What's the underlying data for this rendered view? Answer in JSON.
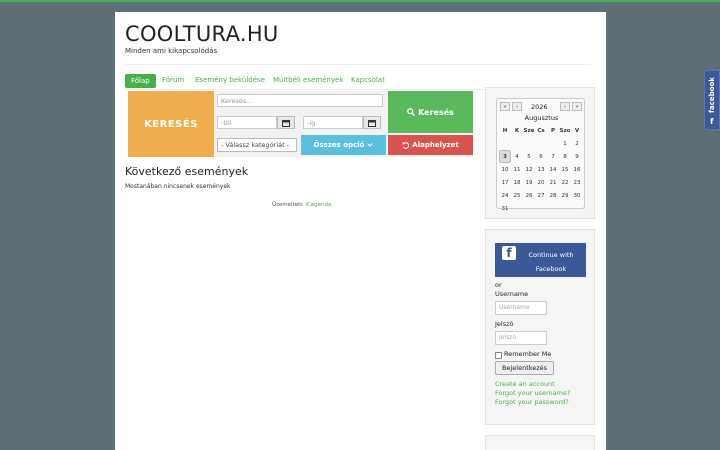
{
  "site": {
    "title": "COOLTURA.HU",
    "subtitle": "Minden ami kikapcsolódás"
  },
  "nav": {
    "items": [
      {
        "label": "Főlap",
        "active": true
      },
      {
        "label": "Fórum"
      },
      {
        "label": "Esemény beküldése"
      },
      {
        "label": "Múltbéli események"
      },
      {
        "label": "Kapcsolat"
      }
    ]
  },
  "search": {
    "label": "KERESÉS",
    "keyword_placeholder": "Keresés...",
    "from_placeholder": "-tól",
    "to_placeholder": "-ig",
    "category_value": "- Válassz kategóriát -",
    "search_button": "Keresés",
    "options_button": "Összes opció",
    "reset_button": "Alaphelyzet"
  },
  "events": {
    "heading": "Következő események",
    "empty_text": "Mostanában nincsenek események",
    "powered_by": "Üzemelteti:",
    "powered_link": "iCagenda"
  },
  "calendar": {
    "nav_prev_year": "«",
    "nav_prev_month": "‹",
    "nav_next_month": "›",
    "nav_next_year": "»",
    "year": "2026",
    "month": "Augusztus",
    "weekdays": [
      "H",
      "K",
      "Sze",
      "Cs",
      "P",
      "Szo",
      "V"
    ],
    "weeks": [
      [
        "",
        "",
        "",
        "",
        "",
        "1",
        "2"
      ],
      [
        "3",
        "4",
        "5",
        "6",
        "7",
        "8",
        "9"
      ],
      [
        "10",
        "11",
        "12",
        "13",
        "14",
        "15",
        "16"
      ],
      [
        "17",
        "18",
        "19",
        "20",
        "21",
        "22",
        "23"
      ],
      [
        "24",
        "25",
        "26",
        "27",
        "28",
        "29",
        "30"
      ],
      [
        "31",
        "",
        "",
        "",
        "",
        "",
        ""
      ]
    ],
    "today": "3"
  },
  "login": {
    "facebook_button": "Continue with Facebook",
    "or": "or",
    "username_label": "Username",
    "username_placeholder": "Username",
    "password_label": "Jelszó",
    "password_placeholder": "Jelszó",
    "remember_label": "Remember Me",
    "login_button": "Bejelentkezés",
    "links": [
      "Create an account",
      "Forgot your username?",
      "Forgot your password?"
    ]
  },
  "facebook_tab": {
    "label": "facebook",
    "glyph": "f"
  },
  "colors": {
    "brand_green": "#46b04a",
    "search_orange": "#f0ad4e",
    "search_green": "#5cb85c",
    "options_blue": "#5bc0de",
    "reset_red": "#d9534f",
    "facebook_blue": "#3b5998",
    "background": "#5f6f78"
  }
}
